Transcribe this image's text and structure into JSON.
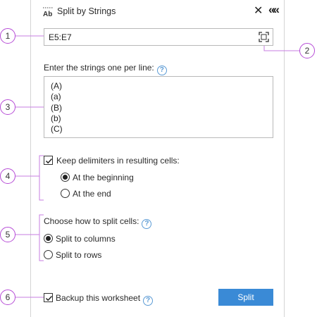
{
  "header": {
    "icon": "ab-text-icon",
    "title": "Split by Strings"
  },
  "range": {
    "value": "E5:E7"
  },
  "strings": {
    "label": "Enter the strings one per line:",
    "lines": [
      "(A)",
      "(a)",
      "(B)",
      "(b)",
      "(C)"
    ]
  },
  "delimiters": {
    "checkbox_label": "Keep delimiters in resulting cells:",
    "checked": true,
    "options": [
      "At the beginning",
      "At the end"
    ],
    "selected": "At the beginning"
  },
  "split": {
    "label": "Choose how to split cells:",
    "options": [
      "Split to columns",
      "Split to rows"
    ],
    "selected": "Split to columns"
  },
  "footer": {
    "backup_label": "Backup this worksheet",
    "backup_checked": true,
    "split_button": "Split"
  },
  "callouts": [
    "1",
    "2",
    "3",
    "4",
    "5",
    "6"
  ],
  "colors": {
    "accent": "#3a8ad6",
    "help": "#5b9bd5",
    "callout": "#b64bd6"
  }
}
